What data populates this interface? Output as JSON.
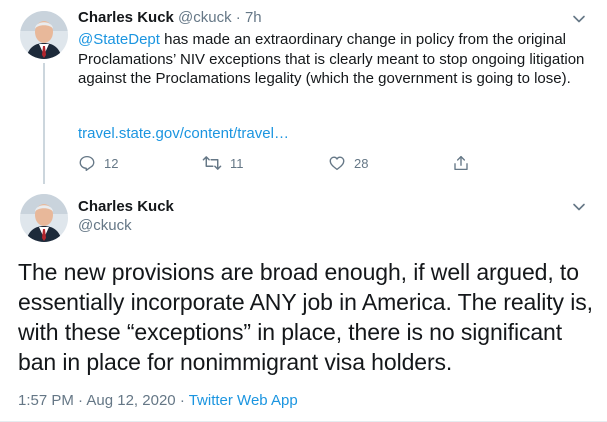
{
  "tweet1": {
    "author_name": "Charles Kuck",
    "handle": "@ckuck",
    "separator": "·",
    "time": "7h",
    "mention": "@StateDept",
    "text": " has made an extraordinary change in policy from the original Proclamations’ NIV exceptions that is clearly meant to stop ongoing litigation against the Proclamations legality (which the government is going to lose).",
    "link": "travel.state.gov/content/travel…",
    "reply_count": "12",
    "retweet_count": "11",
    "like_count": "28"
  },
  "tweet2": {
    "author_name": "Charles Kuck",
    "handle": "@ckuck",
    "text": "The new provisions are broad enough, if well argued, to essentially incorporate ANY job in America.  The reality is, with these “exceptions” in place, there is no significant ban in place for nonimmigrant visa holders.",
    "time": "1:57 PM",
    "dot": "·",
    "date": "Aug 12, 2020",
    "app": "Twitter Web App"
  },
  "colors": {
    "accent": "#1b95e0",
    "muted": "#657786",
    "text": "#14171a",
    "thread_line": "#ccd6dd"
  }
}
